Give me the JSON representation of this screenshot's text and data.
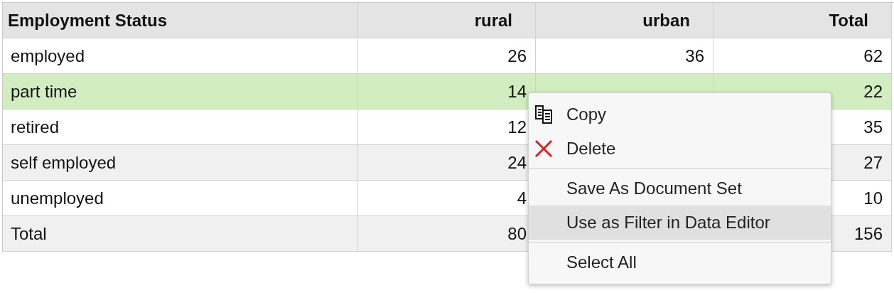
{
  "table": {
    "columns": [
      "Employment Status",
      "rural",
      "urban",
      "Total"
    ],
    "rows": [
      {
        "cells": [
          "employed",
          "26",
          "36",
          "62"
        ],
        "selected": false
      },
      {
        "cells": [
          "part time",
          "14",
          null,
          "22"
        ],
        "selected": true
      },
      {
        "cells": [
          "retired",
          "12",
          null,
          "35"
        ],
        "selected": false
      },
      {
        "cells": [
          "self employed",
          "24",
          null,
          "27"
        ],
        "selected": false
      },
      {
        "cells": [
          "unemployed",
          "4",
          null,
          "10"
        ],
        "selected": false
      },
      {
        "cells": [
          "Total",
          "80",
          null,
          "156"
        ],
        "selected": false
      }
    ]
  },
  "context_menu": {
    "items": [
      {
        "kind": "copy",
        "label": "Copy",
        "highlighted": false
      },
      {
        "kind": "delete",
        "label": "Delete",
        "highlighted": false
      },
      {
        "kind": "separator"
      },
      {
        "kind": "action",
        "label": "Save As Document Set",
        "highlighted": false
      },
      {
        "kind": "action",
        "label": "Use as Filter in Data Editor",
        "highlighted": true
      },
      {
        "kind": "separator"
      },
      {
        "kind": "action",
        "label": "Select All",
        "highlighted": false
      }
    ]
  }
}
